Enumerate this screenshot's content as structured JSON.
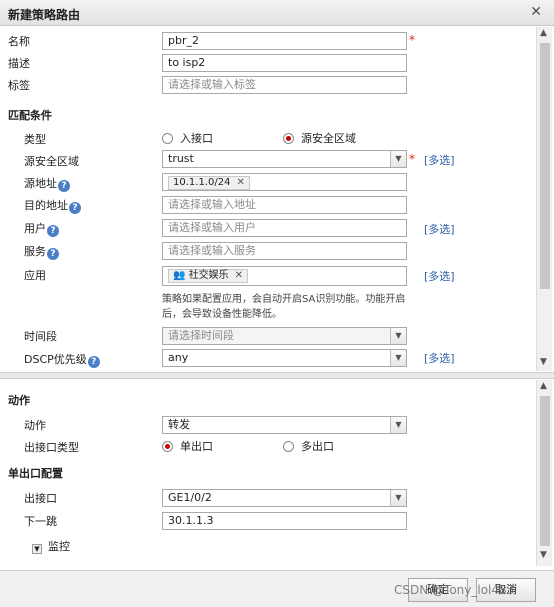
{
  "dialog": {
    "title": "新建策略路由",
    "close_icon": "close-icon"
  },
  "fields": {
    "name_label": "名称",
    "name_value": "pbr_2",
    "desc_label": "描述",
    "desc_value": "to isp2",
    "tag_label": "标签",
    "tag_placeholder": "请选择或输入标签"
  },
  "match": {
    "section": "匹配条件",
    "type_label": "类型",
    "type_opt1": "入接口",
    "type_opt2": "源安全区域",
    "src_zone_label": "源安全区域",
    "src_zone_value": "trust",
    "src_addr_label": "源地址",
    "src_addr_tag": "10.1.1.0/24",
    "dst_addr_label": "目的地址",
    "dst_addr_placeholder": "请选择或输入地址",
    "user_label": "用户",
    "user_placeholder": "请选择或输入用户",
    "service_label": "服务",
    "service_placeholder": "请选择或输入服务",
    "app_label": "应用",
    "app_tag": "社交娱乐",
    "app_hint": "策略如果配置应用，会自动开启SA识别功能。功能开启后，会导致设备性能降低。",
    "time_label": "时间段",
    "time_placeholder": "请选择时间段",
    "dscp_label": "DSCP优先级",
    "dscp_value": "any",
    "multi_select": "[多选]"
  },
  "action": {
    "section": "动作",
    "action_label": "动作",
    "action_value": "转发",
    "egress_type_label": "出接口类型",
    "egress_opt1": "单出口",
    "egress_opt2": "多出口"
  },
  "single_egress": {
    "section": "单出口配置",
    "egress_label": "出接口",
    "egress_value": "GE1/0/2",
    "nexthop_label": "下一跳",
    "nexthop_value": "30.1.1.3",
    "monitor_label": "监控"
  },
  "footer": {
    "ok": "确定",
    "cancel": "取消",
    "watermark": "CSDN @Tony_lol483"
  },
  "colors": {
    "required": "#e21111",
    "link": "#2b5ea8",
    "help_icon": "#4a7fc8"
  }
}
